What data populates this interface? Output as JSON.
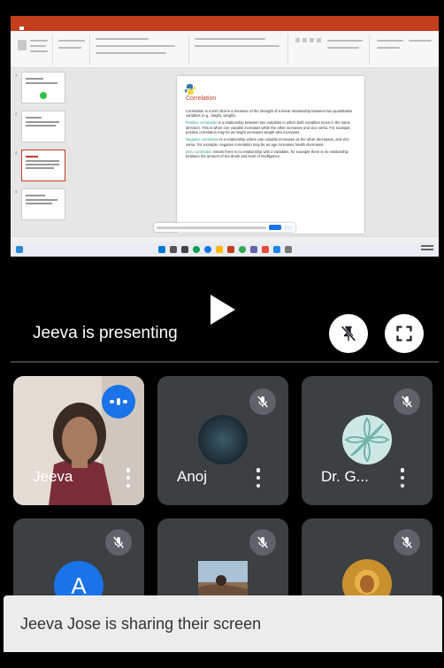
{
  "shared_screen": {
    "slide": {
      "title": "Correlation",
      "paragraphs": [
        {
          "highlight": "",
          "text": "Correlation is a term that is a measure of the strength of a linear relationship between two quantitative variables (e.g., height, weight)."
        },
        {
          "highlight": "Positive correlation",
          "text": " is a relationship between two variables in which both variables move in the same direction. This is when one variable increases while the other increases and vice versa. For example, positive correlation may be as height increases weight also increases."
        },
        {
          "highlight": "Negative correlation",
          "text": " is a relationship where one variable increases as the other decreases, and vice versa. For example, negative correlation may be as age increases health decreases."
        },
        {
          "highlight": "Zero correlation",
          "text": " means there is no relationship with 2 variables, for example there is no relationship between the amount of tea drunk and level of intelligence."
        }
      ]
    },
    "notes_placeholder": "Click to add notes"
  },
  "stage": {
    "presenting_label": "Jeeva is presenting"
  },
  "participants": [
    {
      "name": "Jeeva",
      "speaking": true
    },
    {
      "name": "Anoj",
      "muted": true
    },
    {
      "name": "Dr. G...",
      "muted": true
    },
    {
      "name": "",
      "avatar_letter": "A",
      "muted": true
    },
    {
      "name": "",
      "muted": true
    },
    {
      "name": "",
      "muted": true
    }
  ],
  "toast": {
    "message": "Jeeva Jose is sharing their screen"
  },
  "colors": {
    "tile_bg": "#3c4043",
    "accent_blue": "#1a73e8",
    "ppt_red": "#c43e1c",
    "avatar_A": "#1a73e8"
  },
  "icons": {
    "pin": "pin-off-icon",
    "fullscreen": "fullscreen-icon",
    "mute": "mic-off-icon",
    "play": "play-icon"
  }
}
